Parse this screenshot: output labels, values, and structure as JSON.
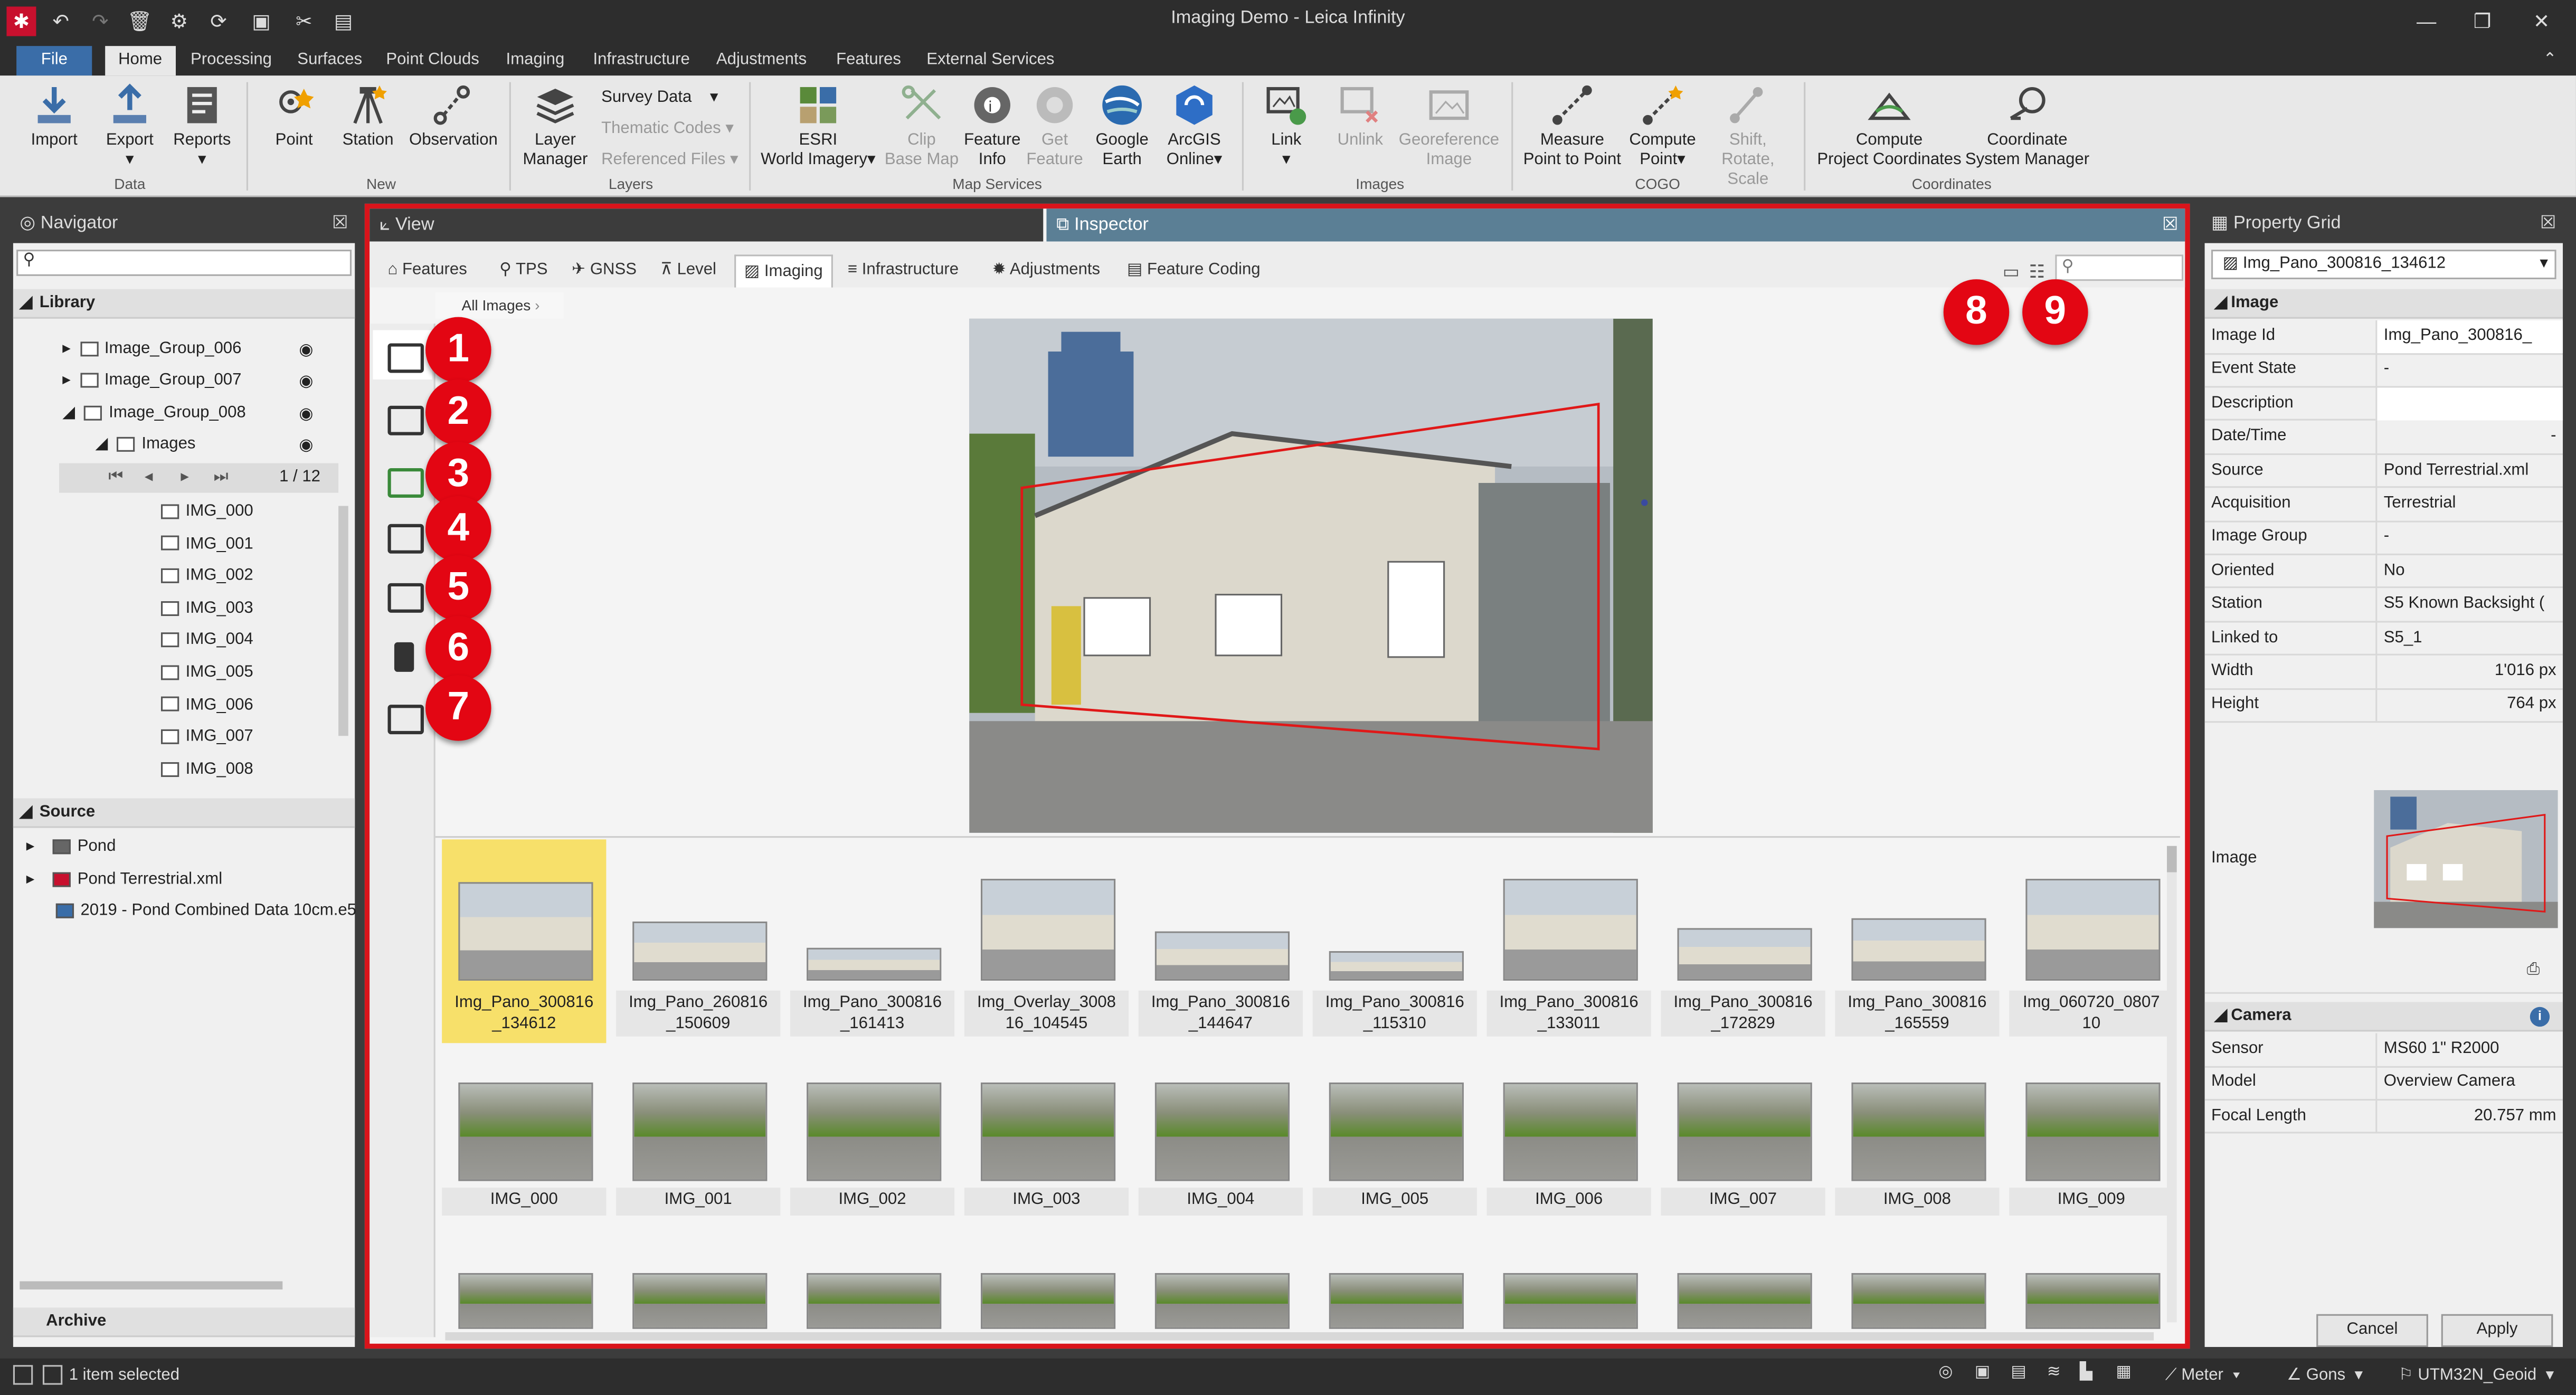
{
  "window": {
    "title": "Imaging Demo - Leica Infinity"
  },
  "menu": {
    "file": "File",
    "tabs": [
      "Home",
      "Processing",
      "Surfaces",
      "Point Clouds",
      "Imaging",
      "Infrastructure",
      "Adjustments",
      "Features",
      "External Services"
    ]
  },
  "ribbon": {
    "import": "Import",
    "export": "Export",
    "reports": "Reports",
    "group_data": "Data",
    "point": "Point",
    "station": "Station",
    "observation": "Observation",
    "group_new": "New",
    "layer_manager_1": "Layer",
    "layer_manager_2": "Manager",
    "survey_data": "Survey Data",
    "thematic_codes": "Thematic Codes",
    "referenced_files": "Referenced Files",
    "group_layers": "Layers",
    "esri_1": "ESRI",
    "esri_2": "World Imagery",
    "clip_1": "Clip",
    "clip_2": "Base Map",
    "feature_info_1": "Feature",
    "feature_info_2": "Info",
    "get_feature_1": "Get",
    "get_feature_2": "Feature",
    "google_1": "Google",
    "google_2": "Earth",
    "arcgis_1": "ArcGIS",
    "arcgis_2": "Online",
    "group_map_services": "Map Services",
    "link": "Link",
    "unlink": "Unlink",
    "georef_1": "Georeference",
    "georef_2": "Image",
    "group_images": "Images",
    "measure_1": "Measure",
    "measure_2": "Point to Point",
    "compute_point_1": "Compute",
    "compute_point_2": "Point",
    "shift_1": "Shift,",
    "shift_2": "Rotate, Scale",
    "group_cogo": "COGO",
    "cpc_1": "Compute",
    "cpc_2": "Project Coordinates",
    "csm_1": "Coordinate",
    "csm_2": "System Manager",
    "group_coordinates": "Coordinates"
  },
  "navigator": {
    "title": "Navigator",
    "library": "Library",
    "groups": [
      "Image_Group_006",
      "Image_Group_007",
      "Image_Group_008"
    ],
    "images_folder": "Images",
    "pager": "1 / 12",
    "images": [
      "IMG_000",
      "IMG_001",
      "IMG_002",
      "IMG_003",
      "IMG_004",
      "IMG_005",
      "IMG_006",
      "IMG_007",
      "IMG_008"
    ],
    "source": "Source",
    "sources": [
      "Pond",
      "Pond Terrestrial.xml",
      "2019 - Pond Combined Data 10cm.e5"
    ],
    "archive": "Archive"
  },
  "view": {
    "title": "View",
    "inspector": "Inspector",
    "tabs": [
      "Features",
      "TPS",
      "GNSS",
      "Level",
      "Imaging",
      "Infrastructure",
      "Adjustments",
      "Feature Coding"
    ],
    "breadcrumb": "All Images",
    "badges": [
      "1",
      "2",
      "3",
      "4",
      "5",
      "6",
      "7",
      "8",
      "9"
    ],
    "thumbs_row1": [
      "Img_Pano_300816\n_134612",
      "Img_Pano_260816\n_150609",
      "Img_Pano_300816\n_161413",
      "Img_Overlay_3008\n16_104545",
      "Img_Pano_300816\n_144647",
      "Img_Pano_300816\n_115310",
      "Img_Pano_300816\n_133011",
      "Img_Pano_300816\n_172829",
      "Img_Pano_300816\n_165559",
      "Img_060720_0807\n10"
    ],
    "thumbs_row2": [
      "IMG_000",
      "IMG_001",
      "IMG_002",
      "IMG_003",
      "IMG_004",
      "IMG_005",
      "IMG_006",
      "IMG_007",
      "IMG_008",
      "IMG_009"
    ]
  },
  "property_grid": {
    "title": "Property Grid",
    "selector": "Img_Pano_300816_134612",
    "section_image": "Image",
    "rows": [
      {
        "k": "Image Id",
        "v": "Img_Pano_300816_"
      },
      {
        "k": "Event State",
        "v": "-"
      },
      {
        "k": "Description",
        "v": ""
      },
      {
        "k": "Date/Time",
        "v": "-"
      },
      {
        "k": "Source",
        "v": "Pond Terrestrial.xml"
      },
      {
        "k": "Acquisition",
        "v": "Terrestrial"
      },
      {
        "k": "Image Group",
        "v": "-"
      },
      {
        "k": "Oriented",
        "v": "No"
      },
      {
        "k": "Station",
        "v": "S5 Known Backsight ("
      },
      {
        "k": "Linked to",
        "v": "S5_1"
      },
      {
        "k": "Width",
        "v": "1'016  px"
      },
      {
        "k": "Height",
        "v": "764  px"
      }
    ],
    "image_label": "Image",
    "section_camera": "Camera",
    "camera_rows": [
      {
        "k": "Sensor",
        "v": "MS60 1\" R2000"
      },
      {
        "k": "Model",
        "v": "Overview Camera"
      },
      {
        "k": "Focal Length",
        "v": "20.757  mm"
      }
    ],
    "cancel": "Cancel",
    "apply": "Apply"
  },
  "status": {
    "selected": "1 item selected",
    "unit": "Meter",
    "angle": "Gons",
    "crs": "UTM32N_Geoid"
  },
  "colors": {
    "accent": "#3a6da8",
    "highlight": "#d9141b",
    "selection": "#f7e06a"
  }
}
